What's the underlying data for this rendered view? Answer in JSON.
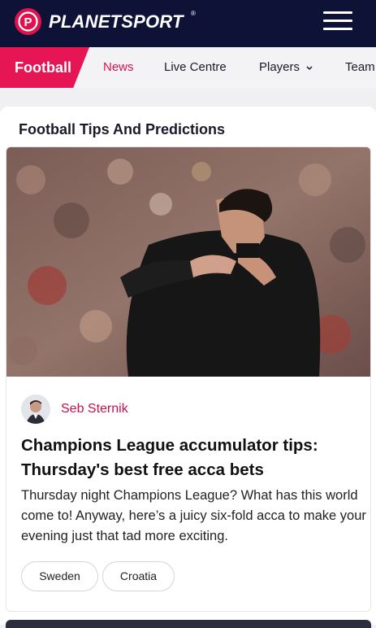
{
  "header": {
    "logo_letter": "P",
    "logo_text": "PLANETSPORT",
    "logo_reg": "®",
    "menu_icon": "hamburger-menu-icon"
  },
  "nav": {
    "active": "Football",
    "items": [
      "News",
      "Live Centre",
      "Players",
      "Team"
    ],
    "players_icon": "chevron-down-icon"
  },
  "section": {
    "title": "Football Tips And Predictions"
  },
  "article": {
    "author": "Seb Sternik",
    "headline": "Champions League accumulator tips: Thursday's best free acca bets",
    "excerpt": "Thursday night Champions League? What has this world come to! Anyway, here’s a juicy six-fold acca to make your evening just that tad more exciting.",
    "tags": [
      "Sweden",
      "Croatia"
    ]
  },
  "colors": {
    "brand": "#e61553",
    "navy": "#0e1236",
    "link": "#c4124a"
  }
}
